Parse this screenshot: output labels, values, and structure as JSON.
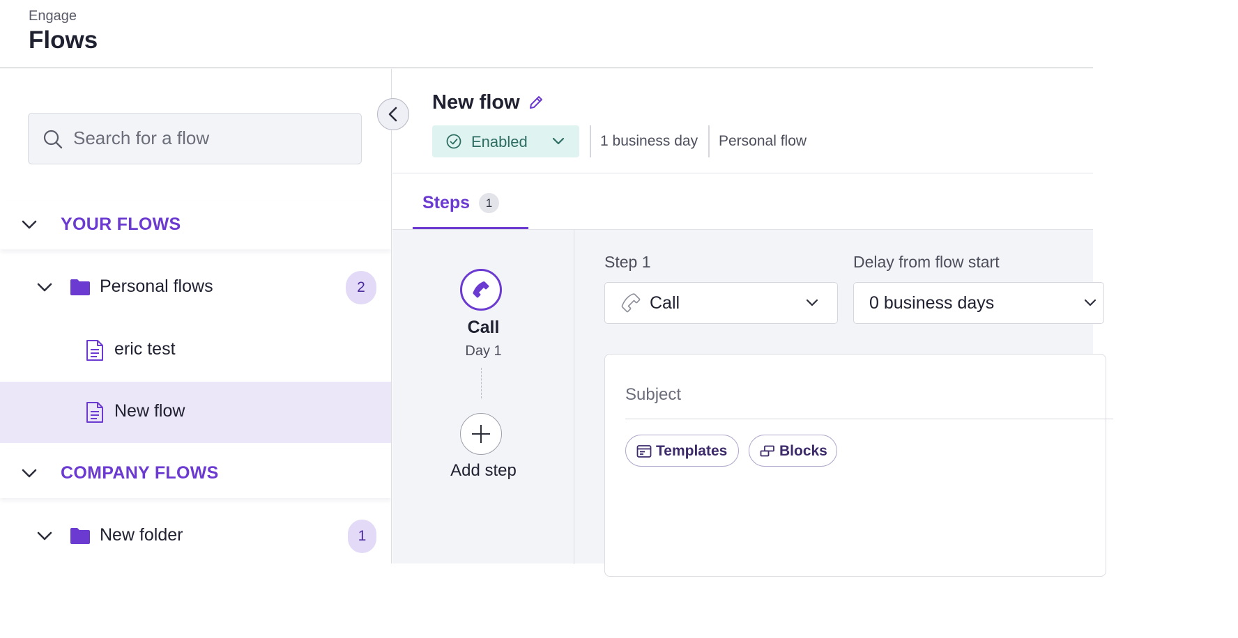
{
  "header": {
    "breadcrumb": "Engage",
    "title": "Flows"
  },
  "sidebar": {
    "search": {
      "placeholder": "Search for a flow",
      "value": ""
    },
    "sections": [
      {
        "label": "YOUR FLOWS",
        "folder": {
          "name": "Personal flows",
          "count": "2"
        },
        "flows": [
          "eric test",
          "New flow"
        ],
        "selected_flow": "New flow"
      },
      {
        "label": "COMPANY FLOWS",
        "folder": {
          "name": "New folder",
          "count": "1"
        }
      }
    ]
  },
  "flow": {
    "name": "New flow",
    "status": "Enabled",
    "duration": "1 business day",
    "type": "Personal flow"
  },
  "tabs": [
    {
      "label": "Steps",
      "count": "1"
    }
  ],
  "steps_rail": {
    "steps": [
      {
        "name": "Call",
        "day": "Day 1",
        "icon": "phone-icon"
      }
    ],
    "add_label": "Add step"
  },
  "step_editor": {
    "step_label": "Step 1",
    "action_type": "Call",
    "delay_label": "Delay from flow start",
    "delay_value": "0 business days",
    "subject_placeholder": "Subject",
    "chips": [
      "Templates",
      "Blocks"
    ]
  },
  "colors": {
    "accent": "#6b3ad1",
    "selected_row": "#ece7f8",
    "status_bg": "#dff3f0",
    "status_text": "#2e6d63"
  }
}
